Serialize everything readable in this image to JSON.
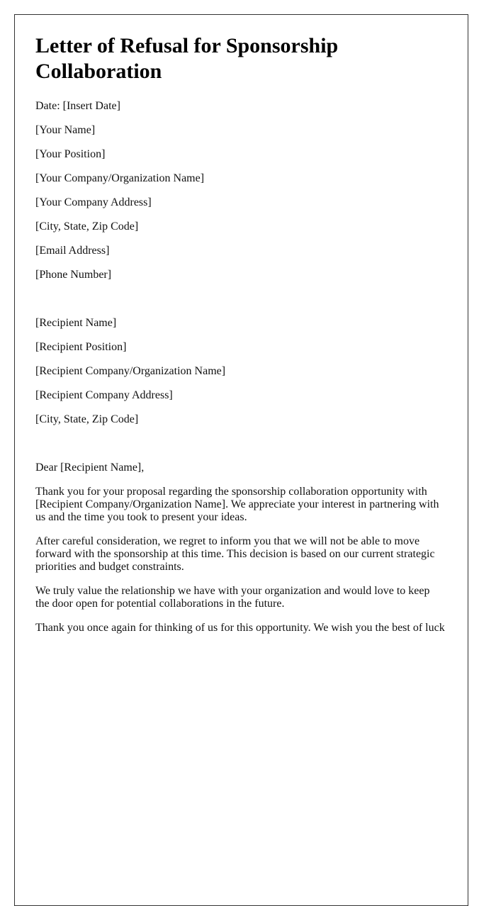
{
  "document": {
    "title": "Letter of Refusal for Sponsorship Collaboration",
    "date_line": "Date: [Insert Date]",
    "sender": {
      "name": "[Your Name]",
      "position": "[Your Position]",
      "company": "[Your Company/Organization Name]",
      "address": "[Your Company Address]",
      "city_state_zip": "[City, State, Zip Code]",
      "email": "[Email Address]",
      "phone": "[Phone Number]"
    },
    "recipient": {
      "name": "[Recipient Name]",
      "position": "[Recipient Position]",
      "company": "[Recipient Company/Organization Name]",
      "address": "[Recipient Company Address]",
      "city_state_zip": "[City, State, Zip Code]"
    },
    "salutation": "Dear [Recipient Name],",
    "body": [
      "Thank you for your proposal regarding the sponsorship collaboration opportunity with [Recipient Company/Organization Name]. We appreciate your interest in partnering with us and the time you took to present your ideas.",
      "After careful consideration, we regret to inform you that we will not be able to move forward with the sponsorship at this time. This decision is based on our current strategic priorities and budget constraints.",
      "We truly value the relationship we have with your organization and would love to keep the door open for potential collaborations in the future.",
      "Thank you once again for thinking of us for this opportunity. We wish you the best of luck"
    ]
  }
}
